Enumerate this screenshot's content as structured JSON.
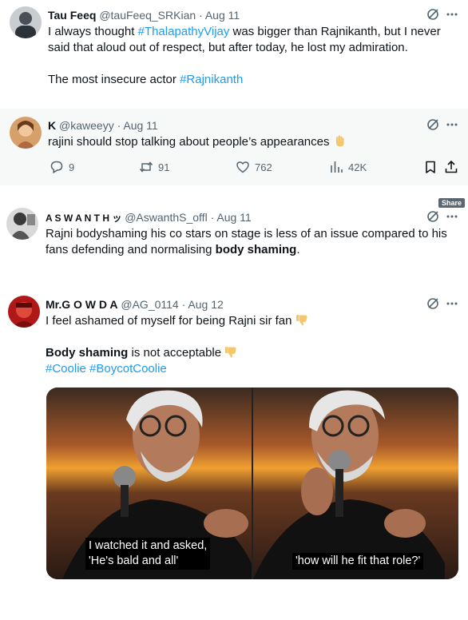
{
  "tweets": [
    {
      "name": "Tau Feeq",
      "handle": "@tauFeeq_SRKian",
      "date": "Aug 11",
      "line1_before": "I always thought ",
      "line1_hashtag": "#ThalapathyVijay",
      "line1_after": " was bigger than Rajnikanth, but I never",
      "line2": "said that aloud out of respect, but after today, he lost my admiration.",
      "line3": "The most insecure actor ",
      "line3_hashtag": "#Rajnikanth"
    },
    {
      "name": "K",
      "handle": "@kaweeyy",
      "date": "Aug 11",
      "text": "rajini should stop talking about people’s appearances",
      "replies": "9",
      "reposts": "91",
      "likes": "762",
      "views": "42K"
    },
    {
      "name": "A S W A N T H ッ",
      "handle": "@AswanthS_offl",
      "date": "Aug 11",
      "line1": "Rajni bodyshaming his co stars on stage is less of an issue compared to his",
      "line2_before": "fans defending and normalising ",
      "line2_bold": "body shaming",
      "line2_after": "."
    },
    {
      "name": "Mr.G O W D A",
      "handle": "@AG_0114",
      "date": "Aug 12",
      "line1": "I feel ashamed of myself for being Rajni sir fan",
      "line2_bold": "Body shaming",
      "line2_after": " is not acceptable",
      "hashtags": "#Coolie #BoycotCoolie",
      "caption_left": "I watched it and asked,\n'He's bald and all'",
      "caption_right": "'how will he fit that role?'"
    }
  ],
  "tooltip": "Share",
  "separator": " · ",
  "icons": [
    "grok-icon",
    "more-icon",
    "reply-icon",
    "repost-icon",
    "like-icon",
    "views-icon",
    "bookmark-icon",
    "share-icon",
    "raised-hand-emoji",
    "thumbs-down-emoji"
  ],
  "colors": {
    "link": "#1d9bf0",
    "secondary": "#536471",
    "quoted_bg": "#f7f9f9"
  }
}
